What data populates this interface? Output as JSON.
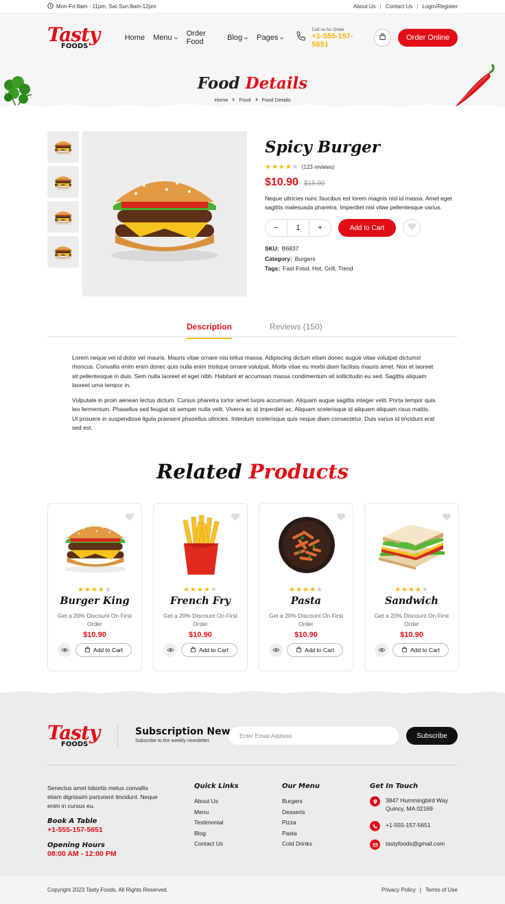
{
  "topbar": {
    "hours": "Mon-Fri:8am - 11pm, Sat-Sun:8am-12pm",
    "links": [
      "About Us",
      "Contact Us",
      "Login/Register"
    ]
  },
  "brand": {
    "name_top": "Tasty",
    "name_bottom": "FOODS"
  },
  "nav": {
    "items": [
      "Home",
      "Menu",
      "Order Food",
      "Blog",
      "Pages"
    ],
    "call_label": "Call us for Order",
    "call_number": "+1-555-157-5651",
    "order_button": "Order Online"
  },
  "hero": {
    "title_part1": "Food",
    "title_part2": "Details",
    "breadcrumb": [
      "Home",
      "Food",
      "Food Details"
    ]
  },
  "product": {
    "name": "Spicy Burger",
    "rating": 4,
    "reviews": "(123 reviews)",
    "price": "$10.90",
    "old_price": "$15.90",
    "description": "Neque ultricies nunc faucibus est lorem magnis nisl id massa. Amet eget sagittis malesuada pharetra. Imperdiet nisl vitae pellentesque varius.",
    "quantity": "1",
    "add_to_cart": "Add to Cart",
    "sku_label": "SKU:",
    "sku": "B6837",
    "category_label": "Category:",
    "category": "Burgers",
    "tags_label": "Tags:",
    "tags": "Fast Food, Hot, Grill, Trend"
  },
  "tabs": {
    "description": "Description",
    "reviews": "Reviews (150)",
    "para1": "Lorem neque vel id dolor vel mauris. Mauris vitae ornare nisi tellus massa. Adipiscing dictum etiam donec augue vitae volutpat dictumst rhoncus. Convallis enim enim donec quis nulla enim tristique ornare volutpat. Morbi vitae eu morbi diam facilisis mauris amet. Non et laoreet sit pellentesque in duis. Sem nulla laoreet et eget nibh. Habitant et accumsan massa condimentum sit sollicitudin eu sed. Sagittis aliquam laoreet urna tempor in.",
    "para2": "Vulputate in proin aenean lectus dictum. Cursus pharetra tortor amet turpis accumsan. Aliquam augue sagittis integer velit. Porta tempor quis leo fermentum. Phasellus sed feugiat sit semper nulla velit. Viverra ac id imperdiet ac. Aliquam scelerisque id aliquam aliquam risus mattis. Ut posuere in suspendisse ligula praesent phasellus ultricies. Interdum scelerisque quis neque diam consectetur. Duis varius id tincidunt erat sed est."
  },
  "related": {
    "title_part1": "Related",
    "title_part2": "Products",
    "items": [
      {
        "name": "Burger King",
        "subtitle": "Get a 20% Discount On First Order",
        "price": "$10.90",
        "button": "Add to Cart",
        "rating": 4
      },
      {
        "name": "French Fry",
        "subtitle": "Get a 20% Discount On First Order",
        "price": "$10.90",
        "button": "Add to Cart",
        "rating": 4
      },
      {
        "name": "Pasta",
        "subtitle": "Get a 20% Discount On First Order",
        "price": "$10.90",
        "button": "Add to Cart",
        "rating": 4
      },
      {
        "name": "Sandwich",
        "subtitle": "Get a 20% Discount On First Order",
        "price": "$10.90",
        "button": "Add to Cart",
        "rating": 4
      }
    ]
  },
  "footer": {
    "subscribe_title": "Subscription News",
    "subscribe_sub": "Subscribe to the weekly newsletter.",
    "email_placeholder": "Enter Email Address",
    "subscribe_button": "Subscribe",
    "about": "Senectus amet lobortis metus convallis etiam dignissim parturient tincidunt. Neque enim in cursus eu.",
    "book_title": "Book A Table",
    "book_number": "+1-555-157-5651",
    "hours_title": "Opening Hours",
    "hours": "08:00 AM - 12:00 PM",
    "quick_links_title": "Quick Links",
    "quick_links": [
      "About Us",
      "Menu",
      "Testimonial",
      "Blog",
      "Contact Us"
    ],
    "menu_title": "Our Menu",
    "menu": [
      "Burgers",
      "Desserts",
      "Pizza",
      "Pasta",
      "Cold Drinks"
    ],
    "contact_title": "Get In Touch",
    "address": "3847 Hummingbird Way Quincy, MA 02169",
    "phone": "+1-555-157-5651",
    "email": "tastyfoods@gmail.com",
    "copyright": "Copyright 2023 Tasty Foods. All Rights Reserved.",
    "legal": [
      "Privacy Policy",
      "Terms of Use"
    ]
  },
  "colors": {
    "accent": "#e10e17",
    "gold": "#f5b70a",
    "dark": "#111111"
  }
}
